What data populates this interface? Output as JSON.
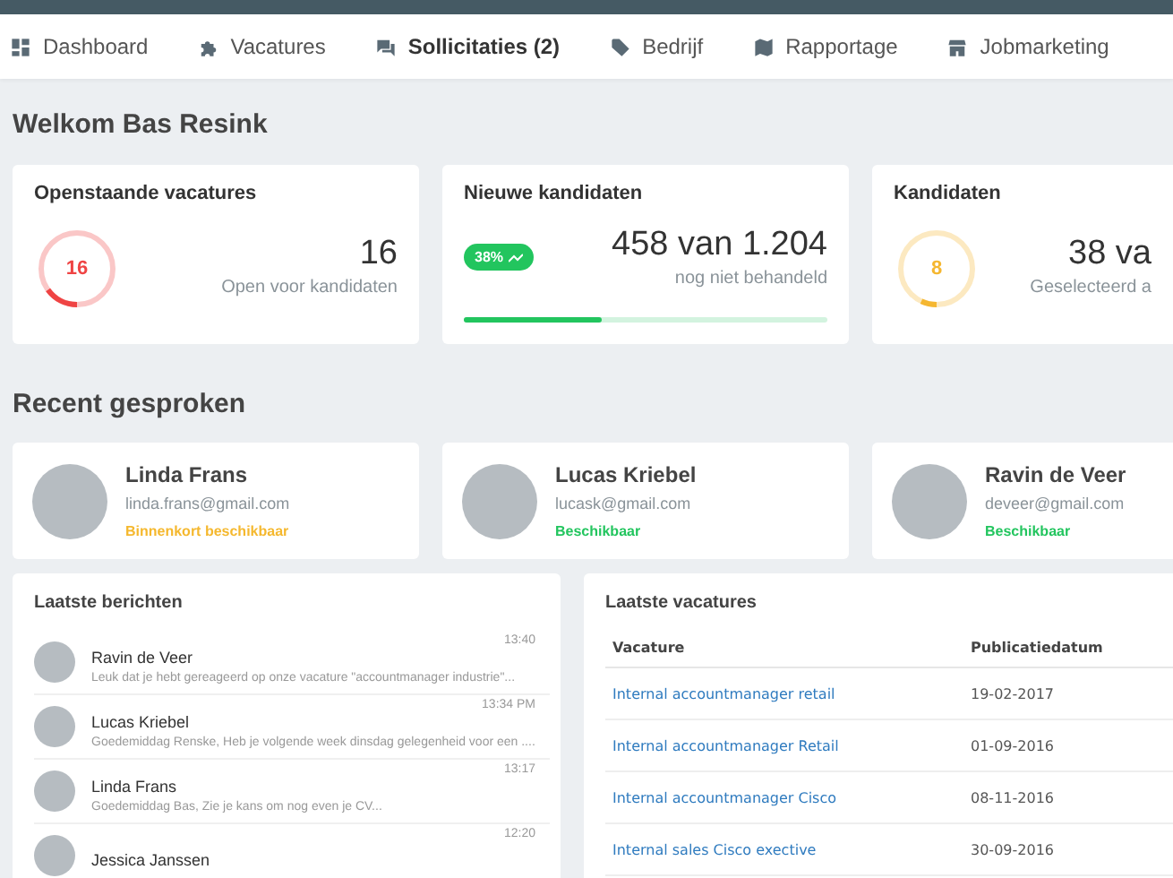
{
  "nav": [
    {
      "label": "Dashboard",
      "selected": false
    },
    {
      "label": "Vacatures",
      "selected": false
    },
    {
      "label": "Sollicitaties (2)",
      "selected": true
    },
    {
      "label": "Bedrijf",
      "selected": false
    },
    {
      "label": "Rapportage",
      "selected": false
    },
    {
      "label": "Jobmarketing",
      "selected": false
    }
  ],
  "welcome": "Welkom Bas Resink",
  "stats": [
    {
      "kind": "ring",
      "title": "Openstaande vacatures",
      "ring_value": "16",
      "level": 0.15,
      "color": "#ef4444",
      "value": "16",
      "caption": "Open voor kandidaten"
    },
    {
      "kind": "progress",
      "title": "Nieuwe kandidaten",
      "badge": "38%",
      "level": 0.38,
      "color": "#22c55e",
      "value": "458 van 1.204",
      "caption": "nog niet behandeld"
    },
    {
      "kind": "ring",
      "title": "Kandidaten",
      "ring_value": "8",
      "level": 0.07,
      "color": "#f5b731",
      "value": "38 va",
      "caption": "Geselecteerd a"
    }
  ],
  "recent_title": "Recent gesproken",
  "contacts": [
    {
      "name": "Linda Frans",
      "email": "linda.frans@gmail.com",
      "status": "Binnenkort beschikbaar",
      "color": "#f5b82e"
    },
    {
      "name": "Lucas Kriebel",
      "email": "lucask@gmail.com",
      "status": "Beschikbaar",
      "color": "#22c55e"
    },
    {
      "name": "Ravin de Veer",
      "email": "deveer@gmail.com",
      "status": "Beschikbaar",
      "color": "#22c55e"
    }
  ],
  "messages": {
    "title": "Laatste berichten",
    "items": [
      {
        "name": "Ravin de Veer",
        "preview": "Leuk dat je hebt gereageerd op onze vacature \"accountmanager industrie\"...",
        "time": "13:40"
      },
      {
        "name": "Lucas Kriebel",
        "preview": "Goedemiddag Renske, Heb je volgende week dinsdag gelegenheid voor een ....",
        "time": "13:34 PM"
      },
      {
        "name": "Linda Frans",
        "preview": "Goedemiddag Bas, Zie je kans om nog even je CV...",
        "time": "13:17"
      },
      {
        "name": "Jessica Janssen",
        "time": "12:20"
      }
    ]
  },
  "vacancies": {
    "title": "Laatste vacatures",
    "columns": [
      "Vacature",
      "Publicatiedatum"
    ],
    "rows": [
      {
        "title": "Internal accountmanager retail",
        "date": "19-02-2017"
      },
      {
        "title": "Internal accountmanager Retail",
        "date": "01-09-2016"
      },
      {
        "title": "Internal accountmanager Cisco",
        "date": "08-11-2016"
      },
      {
        "title": "Internal sales Cisco exective",
        "date": "30-09-2016"
      }
    ]
  }
}
